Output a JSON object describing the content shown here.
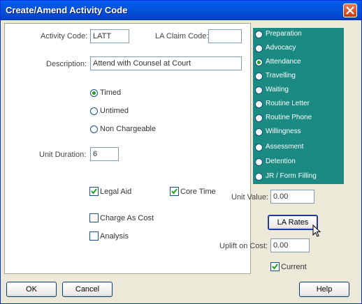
{
  "window": {
    "title": "Create/Amend Activity Code"
  },
  "fields": {
    "activity_code_label": "Activity Code:",
    "activity_code_value": "LATT",
    "la_claim_code_label": "LA Claim Code:",
    "la_claim_code_value": "",
    "description_label": "Description:",
    "description_value": "Attend with Counsel at Court",
    "unit_duration_label": "Unit Duration:",
    "unit_duration_value": "6",
    "unit_value_label": "Unit Value:",
    "unit_value_value": "0.00",
    "uplift_on_cost_label": "Uplift on Cost:",
    "uplift_on_cost_value": "0.00"
  },
  "timing_options": [
    {
      "label": "Timed",
      "selected": true
    },
    {
      "label": "Untimed",
      "selected": false
    },
    {
      "label": "Non Chargeable",
      "selected": false
    }
  ],
  "checkboxes": {
    "legal_aid": {
      "label": "Legal Aid",
      "checked": true
    },
    "core_time": {
      "label": "Core Time",
      "checked": true
    },
    "charge_as_cost": {
      "label": "Charge As Cost",
      "checked": false
    },
    "analysis": {
      "label": "Analysis",
      "checked": false
    },
    "current": {
      "label": "Current",
      "checked": true
    }
  },
  "category_options": [
    {
      "label": "Preparation",
      "selected": false
    },
    {
      "label": "Advocacy",
      "selected": false
    },
    {
      "label": "Attendance",
      "selected": true
    },
    {
      "label": "Travelling",
      "selected": false
    },
    {
      "label": "Waiting",
      "selected": false
    },
    {
      "label": "Routine Letter",
      "selected": false
    },
    {
      "label": "Routine Phone",
      "selected": false
    },
    {
      "label": "Willingness",
      "selected": false
    },
    {
      "label": "Assessment",
      "selected": false
    },
    {
      "label": "Detention",
      "selected": false
    },
    {
      "label": "JR / Form Filling",
      "selected": false
    }
  ],
  "buttons": {
    "la_rates": "LA Rates",
    "ok": "OK",
    "cancel": "Cancel",
    "help": "Help"
  },
  "colors": {
    "titlebar": "#0453d8",
    "category_panel": "#1a8a82",
    "radio_dot": "#21a121"
  }
}
